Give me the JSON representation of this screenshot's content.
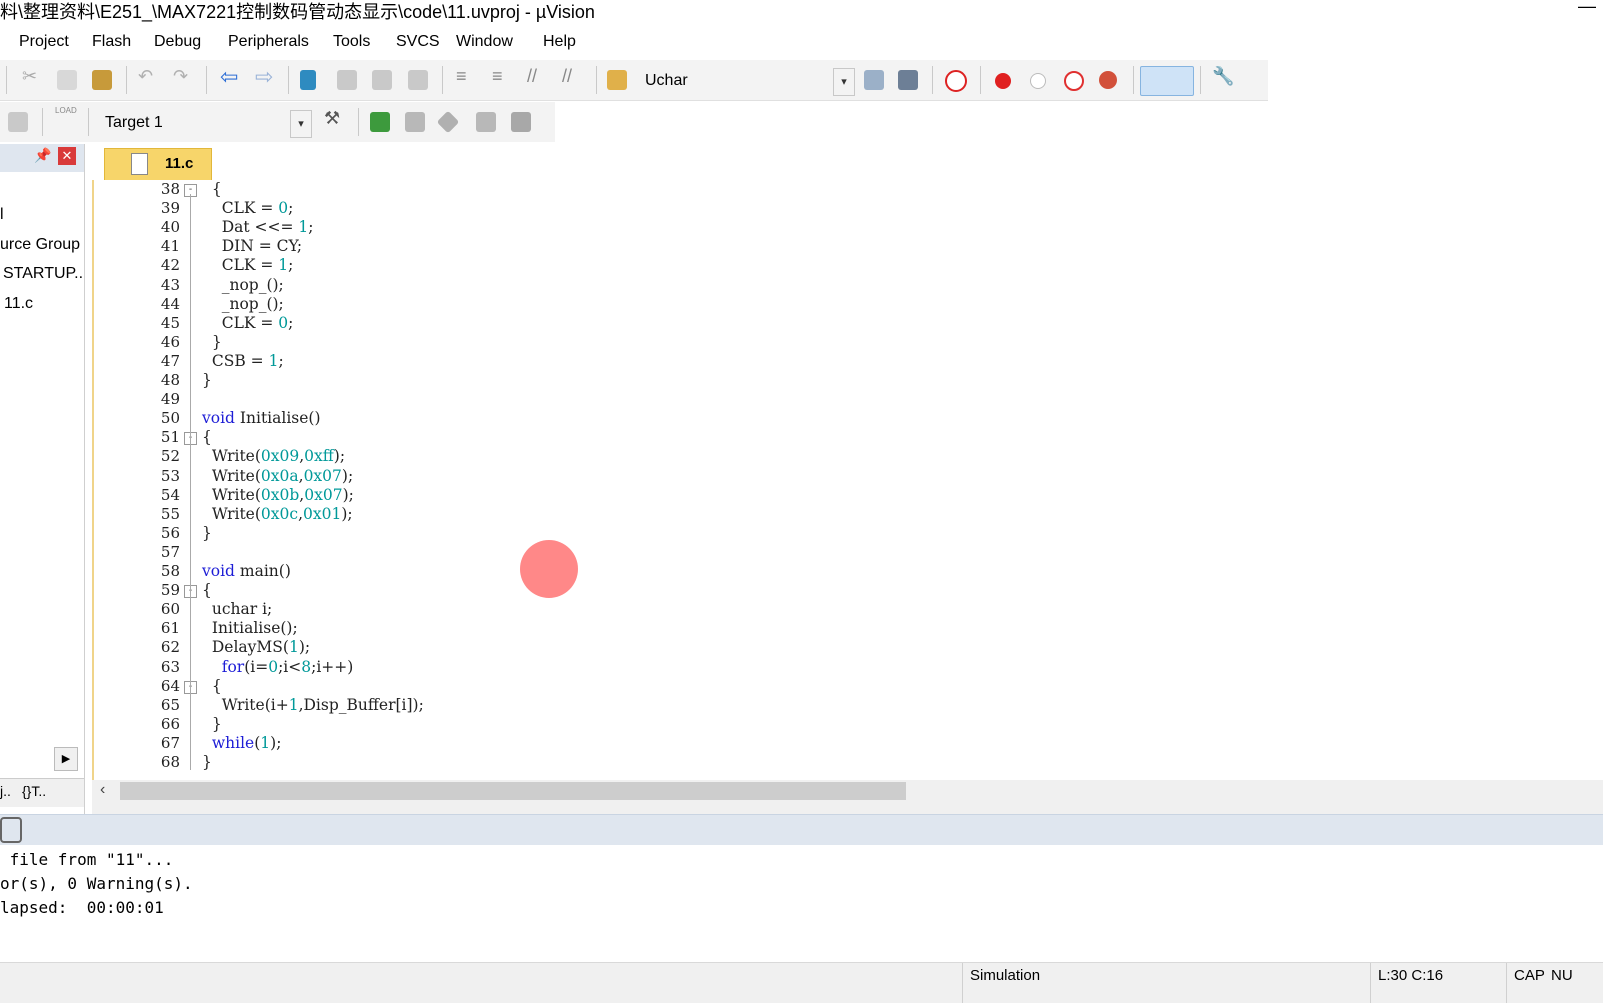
{
  "window": {
    "title": "料\\整理资料\\E251_\\MAX7221控制数码管动态显示\\code\\11.uvproj - µVision",
    "minimize_glyph": "—"
  },
  "menu": [
    "Project",
    "Flash",
    "Debug",
    "Peripherals",
    "Tools",
    "SVCS",
    "Window",
    "Help"
  ],
  "toolbar": {
    "find_combo_value": "Uchar",
    "target_combo_value": "Target 1",
    "load_label": "LOAD"
  },
  "project_panel": {
    "items": [
      {
        "label": "l"
      },
      {
        "label": "urce Group"
      },
      {
        "label": "STARTUP.."
      },
      {
        "label": "11.c"
      }
    ],
    "bottom_tabs": [
      "j..",
      "{}T.."
    ]
  },
  "editor": {
    "tab_label": "11.c",
    "lines": [
      {
        "n": "38",
        "fold": "-",
        "tokens": [
          [
            "t",
            "  {"
          ]
        ]
      },
      {
        "n": "39",
        "tokens": [
          [
            "t",
            "    CLK = "
          ],
          [
            "num",
            "0"
          ],
          [
            "t",
            ";"
          ]
        ]
      },
      {
        "n": "40",
        "tokens": [
          [
            "t",
            "    Dat <<= "
          ],
          [
            "num",
            "1"
          ],
          [
            "t",
            ";"
          ]
        ]
      },
      {
        "n": "41",
        "tokens": [
          [
            "t",
            "    DIN = CY;"
          ]
        ]
      },
      {
        "n": "42",
        "tokens": [
          [
            "t",
            "    CLK = "
          ],
          [
            "num",
            "1"
          ],
          [
            "t",
            ";"
          ]
        ]
      },
      {
        "n": "43",
        "tokens": [
          [
            "t",
            "    _nop_();"
          ]
        ]
      },
      {
        "n": "44",
        "tokens": [
          [
            "t",
            "    _nop_();"
          ]
        ]
      },
      {
        "n": "45",
        "tokens": [
          [
            "t",
            "    CLK = "
          ],
          [
            "num",
            "0"
          ],
          [
            "t",
            ";"
          ]
        ]
      },
      {
        "n": "46",
        "tokens": [
          [
            "t",
            "  }"
          ]
        ]
      },
      {
        "n": "47",
        "tokens": [
          [
            "t",
            "  CSB = "
          ],
          [
            "num",
            "1"
          ],
          [
            "t",
            ";"
          ]
        ]
      },
      {
        "n": "48",
        "tokens": [
          [
            "t",
            "}"
          ]
        ]
      },
      {
        "n": "49",
        "tokens": [
          [
            "t",
            ""
          ]
        ]
      },
      {
        "n": "50",
        "tokens": [
          [
            "kw",
            "void"
          ],
          [
            "t",
            " Initialise()"
          ]
        ]
      },
      {
        "n": "51",
        "fold": "-",
        "tokens": [
          [
            "t",
            "{"
          ]
        ]
      },
      {
        "n": "52",
        "tokens": [
          [
            "t",
            "  Write("
          ],
          [
            "num",
            "0x09"
          ],
          [
            "t",
            ","
          ],
          [
            "num",
            "0xff"
          ],
          [
            "t",
            ");"
          ]
        ]
      },
      {
        "n": "53",
        "tokens": [
          [
            "t",
            "  Write("
          ],
          [
            "num",
            "0x0a"
          ],
          [
            "t",
            ","
          ],
          [
            "num",
            "0x07"
          ],
          [
            "t",
            ");"
          ]
        ]
      },
      {
        "n": "54",
        "tokens": [
          [
            "t",
            "  Write("
          ],
          [
            "num",
            "0x0b"
          ],
          [
            "t",
            ","
          ],
          [
            "num",
            "0x07"
          ],
          [
            "t",
            ");"
          ]
        ]
      },
      {
        "n": "55",
        "tokens": [
          [
            "t",
            "  Write("
          ],
          [
            "num",
            "0x0c"
          ],
          [
            "t",
            ","
          ],
          [
            "num",
            "0x01"
          ],
          [
            "t",
            ");"
          ]
        ]
      },
      {
        "n": "56",
        "tokens": [
          [
            "t",
            "}"
          ]
        ]
      },
      {
        "n": "57",
        "tokens": [
          [
            "t",
            ""
          ]
        ]
      },
      {
        "n": "58",
        "tokens": [
          [
            "kw",
            "void"
          ],
          [
            "t",
            " main()"
          ]
        ]
      },
      {
        "n": "59",
        "fold": "-",
        "tokens": [
          [
            "t",
            "{"
          ]
        ]
      },
      {
        "n": "60",
        "tokens": [
          [
            "t",
            "  uchar i;"
          ]
        ]
      },
      {
        "n": "61",
        "tokens": [
          [
            "t",
            "  Initialise();"
          ]
        ]
      },
      {
        "n": "62",
        "tokens": [
          [
            "t",
            "  DelayMS("
          ],
          [
            "num",
            "1"
          ],
          [
            "t",
            ");"
          ]
        ]
      },
      {
        "n": "63",
        "tokens": [
          [
            "t",
            "    "
          ],
          [
            "kw",
            "for"
          ],
          [
            "t",
            "(i="
          ],
          [
            "num",
            "0"
          ],
          [
            "t",
            ";i<"
          ],
          [
            "num",
            "8"
          ],
          [
            "t",
            ";i++)"
          ]
        ]
      },
      {
        "n": "64",
        "fold": "-",
        "tokens": [
          [
            "t",
            "  {"
          ]
        ]
      },
      {
        "n": "65",
        "tokens": [
          [
            "t",
            "    Write(i+"
          ],
          [
            "num",
            "1"
          ],
          [
            "t",
            ",Disp_Buffer[i]);"
          ]
        ]
      },
      {
        "n": "66",
        "tokens": [
          [
            "t",
            "  }"
          ]
        ]
      },
      {
        "n": "67",
        "tokens": [
          [
            "t",
            "  "
          ],
          [
            "kw",
            "while"
          ],
          [
            "t",
            "("
          ],
          [
            "num",
            "1"
          ],
          [
            "t",
            ");"
          ]
        ]
      },
      {
        "n": "68",
        "tokens": [
          [
            "t",
            "}"
          ]
        ]
      }
    ]
  },
  "build_output": {
    "lines": [
      " file from \"11\"...",
      "or(s), 0 Warning(s).",
      "lapsed:  00:00:01"
    ]
  },
  "statusbar": {
    "mode": "Simulation",
    "position": "L:30 C:16",
    "caps": "CAP",
    "num": "NU"
  },
  "colors": {
    "keyword": "#1d1dd6",
    "number": "#009999",
    "tab_active": "#f7d56a",
    "cursor_marker": "#ff7b7b"
  }
}
